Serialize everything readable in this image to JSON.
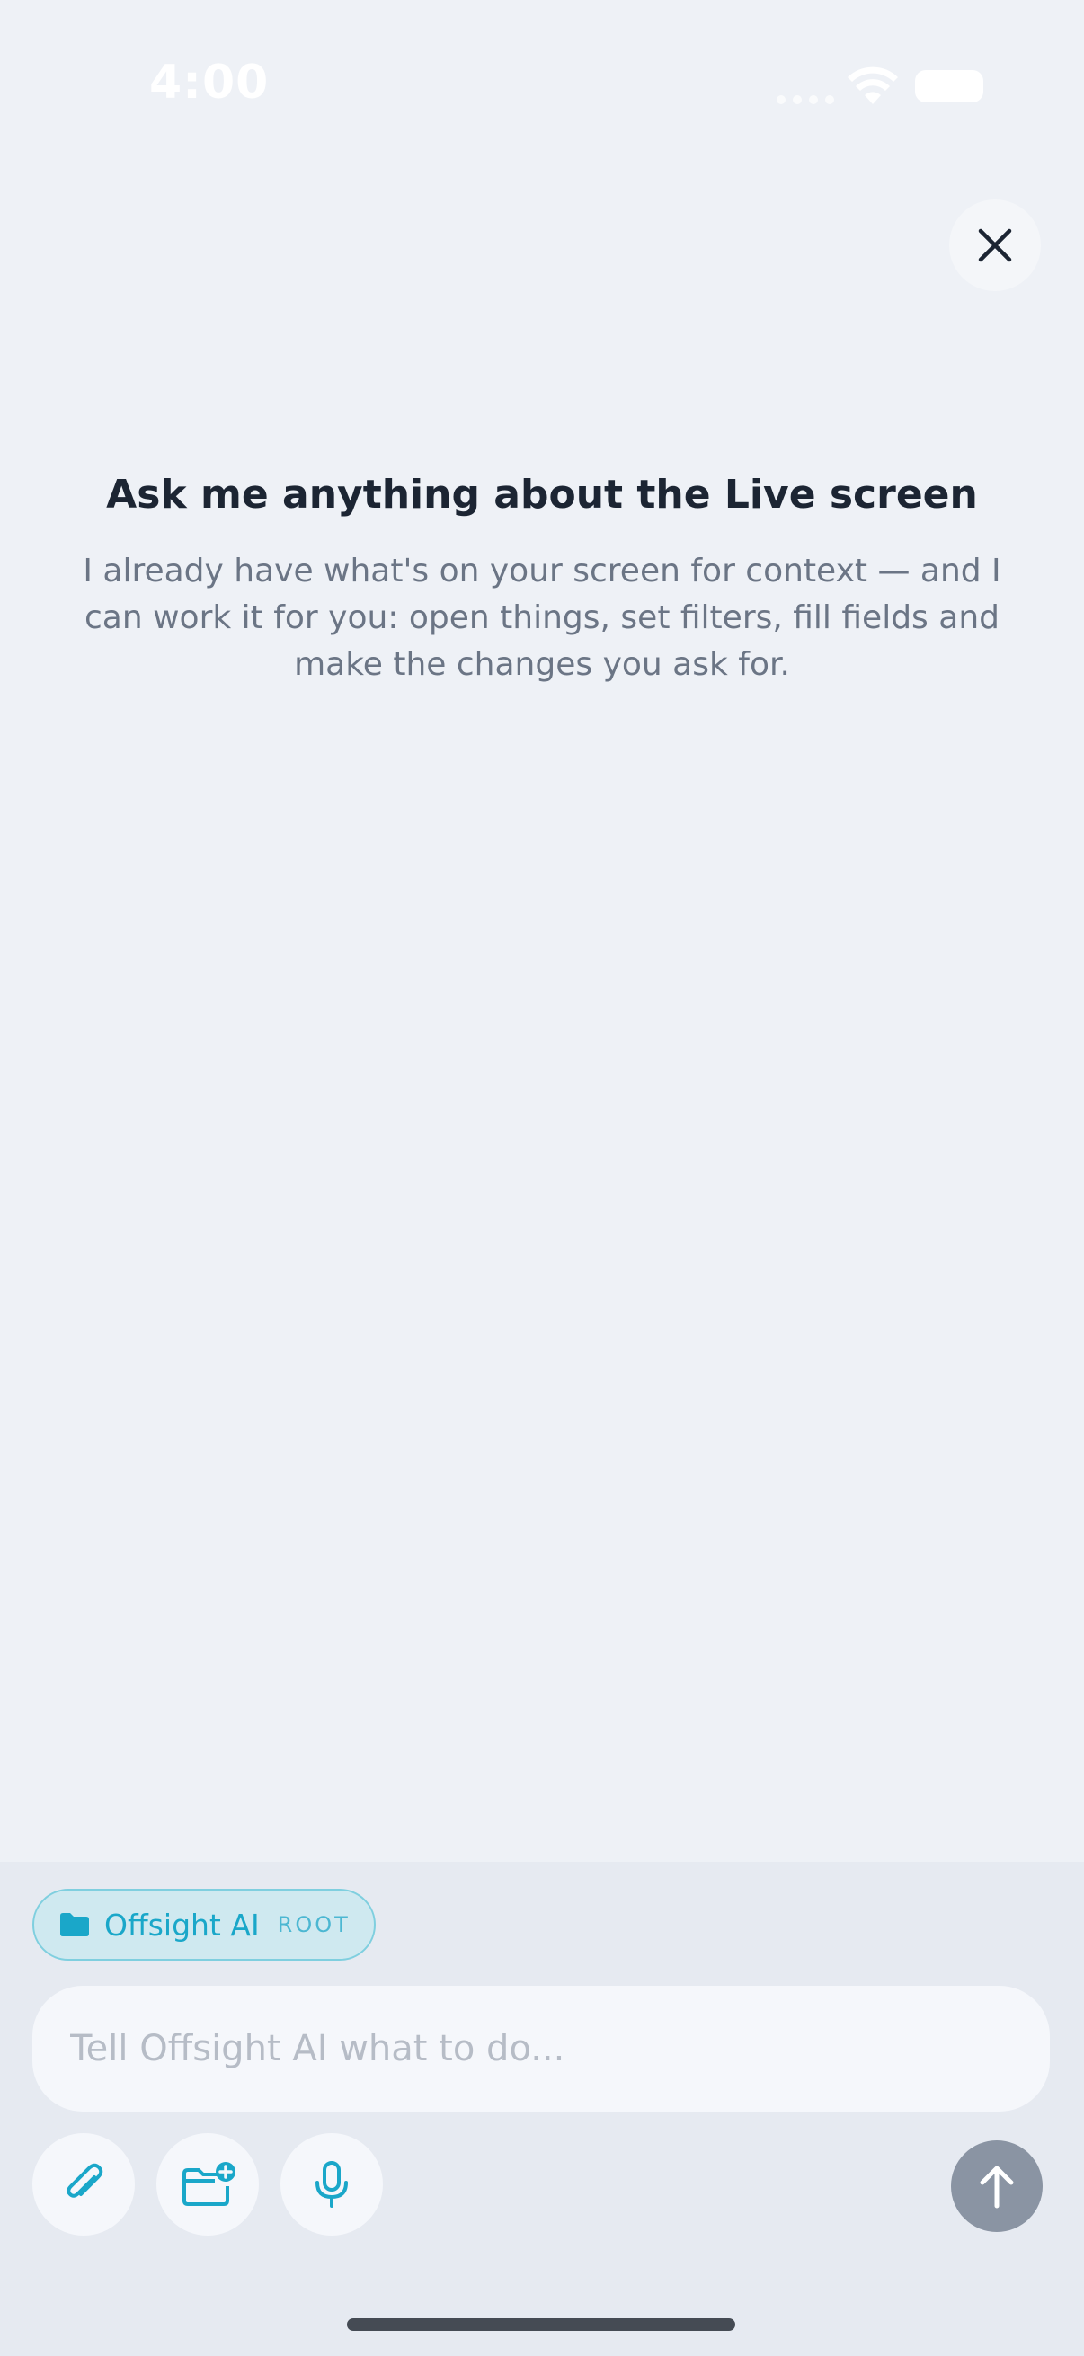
{
  "status_bar": {
    "time": "4:00"
  },
  "intro": {
    "title": "Ask me anything about the Live screen",
    "body": "I already have what's on your screen for context — and I can work it for you: open things, set filters, fill fields and make the changes you ask for."
  },
  "composer": {
    "context_chip": {
      "label": "Offsight AI",
      "tag": "ROOT"
    },
    "input": {
      "value": "",
      "placeholder": "Tell Offsight AI what to do..."
    },
    "tools": [
      "paperclip-icon",
      "folder-add-icon",
      "microphone-icon"
    ],
    "send_icon": "arrow-up-icon"
  },
  "colors": {
    "background": "#eef1f6",
    "composer_background": "#e6eaf1",
    "accent": "#1aa7c9",
    "chip_background": "#cfe9f0",
    "send_button": "#8a94a3",
    "title_text": "#1c2533",
    "body_text": "#6b7585"
  }
}
